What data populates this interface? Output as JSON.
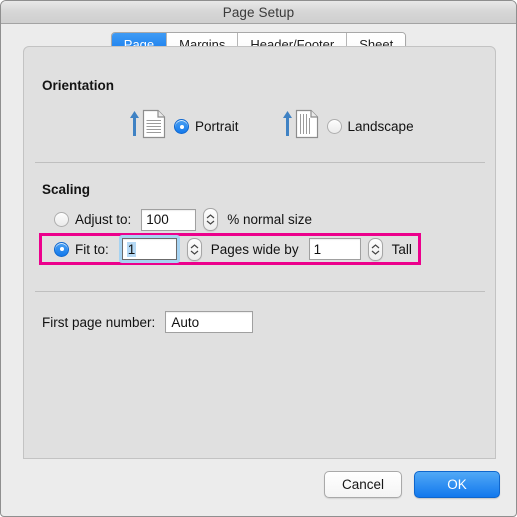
{
  "window": {
    "title": "Page Setup"
  },
  "tabs": [
    {
      "label": "Page",
      "name": "tab-page",
      "active": true
    },
    {
      "label": "Margins",
      "name": "tab-margins",
      "active": false
    },
    {
      "label": "Header/Footer",
      "name": "tab-header-footer",
      "active": false
    },
    {
      "label": "Sheet",
      "name": "tab-sheet",
      "active": false
    }
  ],
  "orientation": {
    "section_label": "Orientation",
    "portrait": {
      "label": "Portrait",
      "selected": true,
      "icon": "portrait-page-icon"
    },
    "landscape": {
      "label": "Landscape",
      "selected": false,
      "icon": "landscape-page-icon"
    }
  },
  "scaling": {
    "section_label": "Scaling",
    "adjust_to": {
      "label": "Adjust to:",
      "selected": false,
      "value": "100",
      "suffix_label": "% normal size"
    },
    "fit_to": {
      "label": "Fit to:",
      "selected": true,
      "pages_wide_value": "1",
      "pages_wide_label": "Pages wide by",
      "tall_value": "1",
      "tall_label": "Tall",
      "highlight_color": "#ec008c"
    }
  },
  "first_page_number": {
    "label": "First page number:",
    "value": "Auto",
    "placeholder": "Auto"
  },
  "footer": {
    "cancel_label": "Cancel",
    "ok_label": "OK"
  },
  "colors": {
    "accent_blue": "#1278ed",
    "highlight_magenta": "#ec008c",
    "panel_bg": "#e0e0e0",
    "window_bg": "#ececec"
  }
}
